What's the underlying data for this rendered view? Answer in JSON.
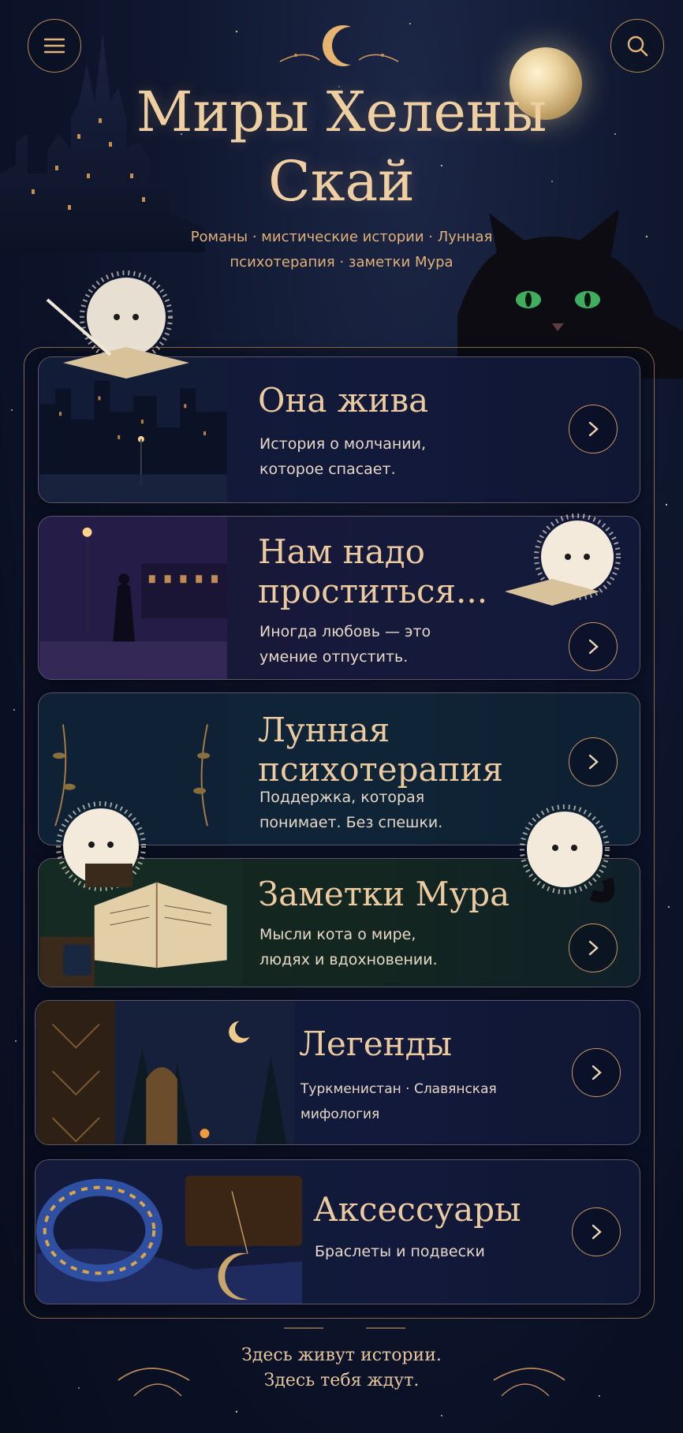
{
  "header": {
    "title": "Миры Хелены Скай",
    "subtitle": "Романы · мистические истории · Лунная психотерапия · заметки Мура",
    "menu_icon": "hamburger-menu-icon",
    "search_icon": "search-icon"
  },
  "cards": [
    {
      "title": "Она жива",
      "text": "История о молчании, которое спасает."
    },
    {
      "title": "Нам надо проститься...",
      "text": "Иногда любовь — это умение отпустить."
    },
    {
      "title": "Лунная психотерапия",
      "text": "Поддержка, которая понимает. Без спешки."
    },
    {
      "title": "Заметки Мура",
      "text": "Мысли кота о мире, людях и вдохновении."
    },
    {
      "title": "Легенды",
      "text": "Туркменистан · Славянская мифология"
    },
    {
      "title": "Аксессуары",
      "text": "Браслеты и подвески"
    }
  ],
  "footer": {
    "line1": "Здесь живут истории.",
    "line2": "Здесь тебя ждут."
  },
  "colors": {
    "background": "#0b1126",
    "accent_gold": "#e8c79a",
    "border": "#8c6a47"
  }
}
